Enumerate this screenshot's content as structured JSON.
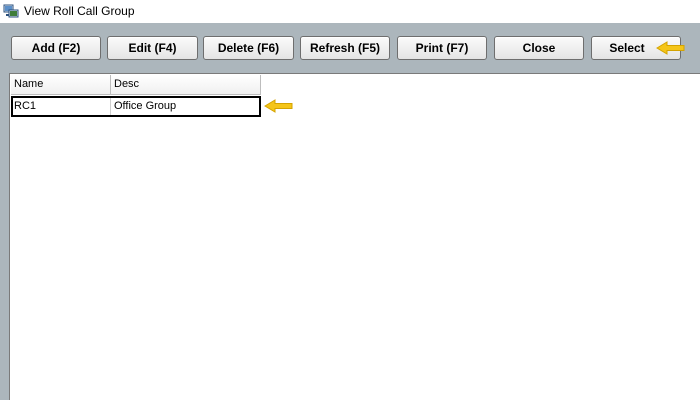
{
  "window": {
    "title": "View Roll Call Group",
    "icon": "roll-call-app-icon"
  },
  "toolbar": {
    "add_label": "Add (F2)",
    "edit_label": "Edit (F4)",
    "delete_label": "Delete (F6)",
    "refresh_label": "Refresh (F5)",
    "print_label": "Print (F7)",
    "close_label": "Close",
    "select_label": "Select"
  },
  "grid": {
    "columns": [
      "Name",
      "Desc"
    ],
    "rows": [
      {
        "name": "RC1",
        "desc": "Office Group",
        "selected": true
      }
    ]
  },
  "colors": {
    "client_background": "#acb6bc",
    "annotation_arrow": "#f5c518"
  }
}
